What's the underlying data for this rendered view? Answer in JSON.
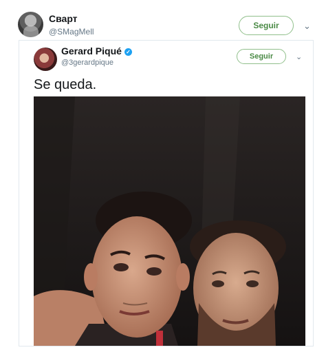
{
  "outer_tweet": {
    "display_name": "Сварт",
    "handle": "@SMagMell",
    "follow_label": "Seguir",
    "menu_icon": "chevron-down-icon"
  },
  "quoted_tweet": {
    "display_name": "Gerard Piqué",
    "verified_icon": "verified-badge-icon",
    "handle": "@3gerardpique",
    "follow_label": "Seguir",
    "menu_icon": "chevron-down-icon",
    "text": "Se queda.",
    "media": "selfie-photo"
  },
  "colors": {
    "follow_accent": "#4a8a45",
    "follow_border": "#8fbf8a",
    "handle_gray": "#657786",
    "verified_blue": "#1da1f2"
  }
}
